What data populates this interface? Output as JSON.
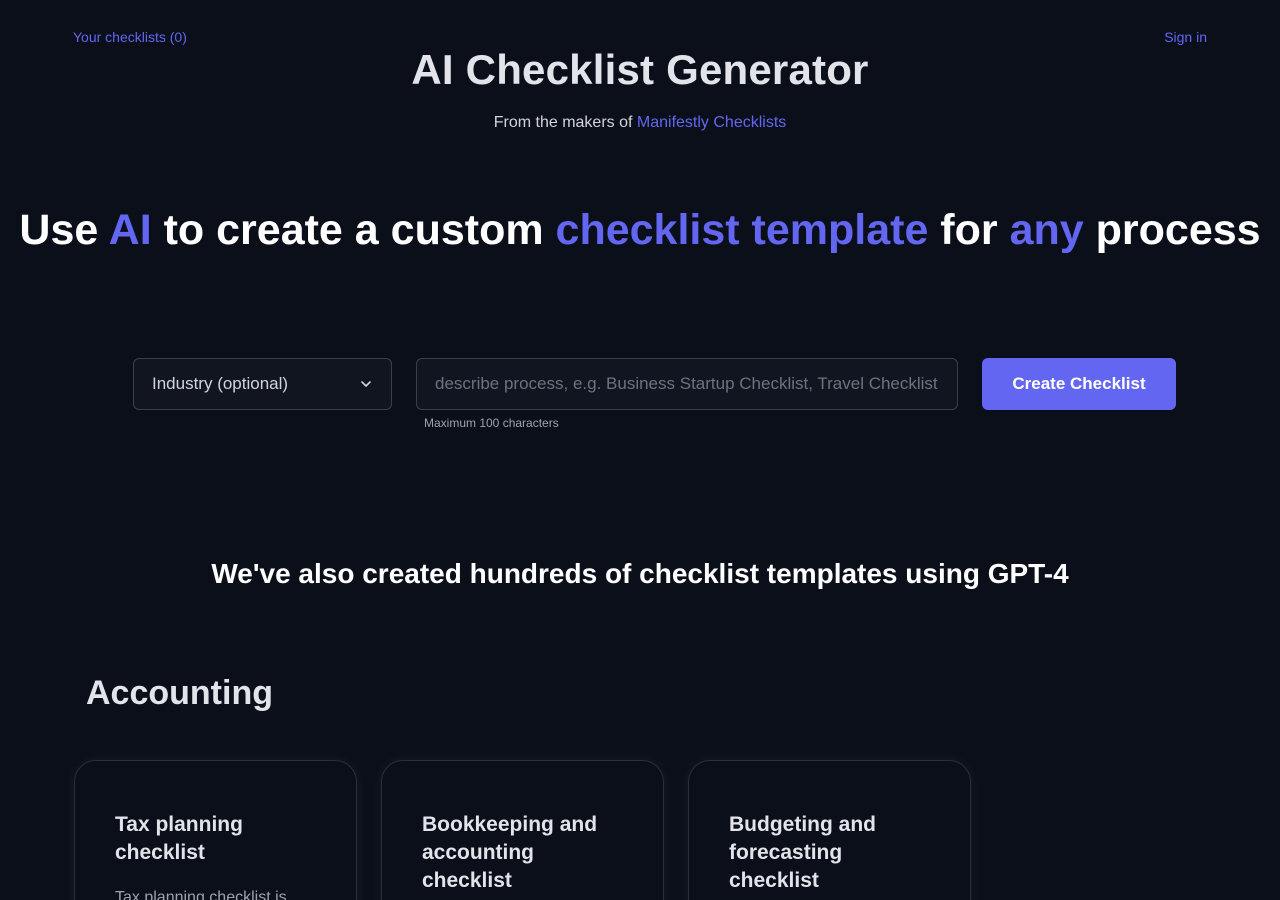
{
  "nav": {
    "checklists_link": "Your checklists (0)",
    "sign_in_link": "Sign in"
  },
  "header": {
    "title": "AI Checklist Generator",
    "subtitle_prefix": "From the makers of ",
    "subtitle_link": "Manifestly Checklists"
  },
  "hero": {
    "part1": "Use ",
    "part2": "AI",
    "part3": " to create a custom ",
    "part4": "checklist template",
    "part5": " for ",
    "part6": "any",
    "part7": " process"
  },
  "form": {
    "industry_select": "Industry (optional)",
    "process_placeholder": "describe process, e.g. Business Startup Checklist, Travel Checklist, etc.",
    "process_value": "",
    "hint": "Maximum 100 characters",
    "create_button": "Create Checklist"
  },
  "templates_heading": "We've also created hundreds of checklist templates using GPT-4",
  "category": {
    "title": "Accounting",
    "cards": [
      {
        "title": "Tax planning checklist",
        "description": "Tax planning checklist is"
      },
      {
        "title": "Bookkeeping and accounting checklist",
        "description": ""
      },
      {
        "title": "Budgeting and forecasting checklist",
        "description": ""
      }
    ]
  },
  "colors": {
    "background": "#0b0f1a",
    "accent": "#6366f1",
    "text": "#ffffff",
    "muted": "#9ca3af"
  },
  "icons": {
    "select_chevron": "chevron-down-icon"
  }
}
